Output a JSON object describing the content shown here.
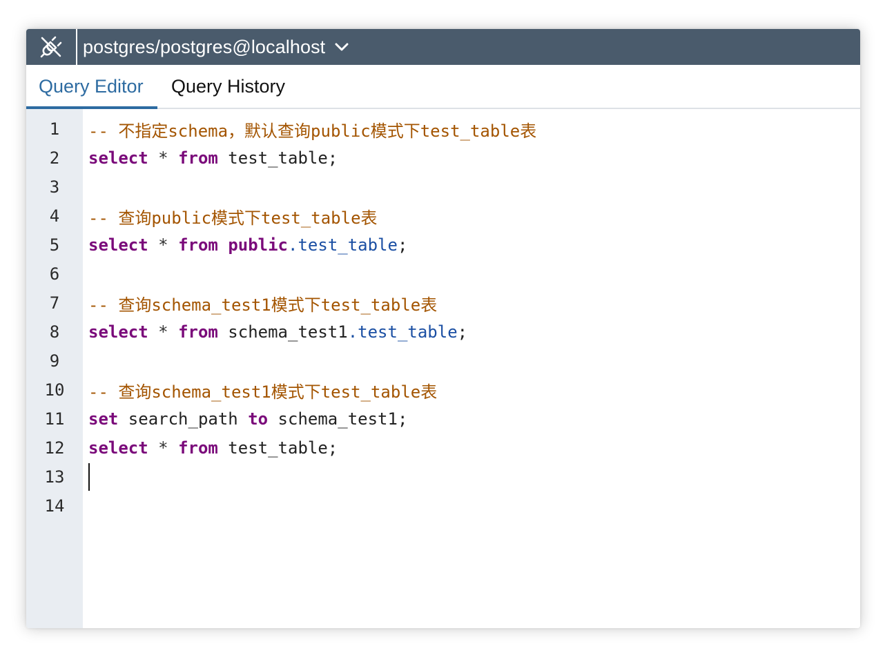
{
  "connection": {
    "label": "postgres/postgres@localhost",
    "icon": "disconnected-plug-icon",
    "dropdown_icon": "chevron-down-icon"
  },
  "tabs": [
    {
      "label": "Query Editor",
      "active": true
    },
    {
      "label": "Query History",
      "active": false
    }
  ],
  "editor": {
    "lines": [
      {
        "num": "1",
        "tokens": [
          {
            "t": "-- 不指定schema，默认查询public模式下test_table表",
            "c": "comment"
          }
        ]
      },
      {
        "num": "2",
        "tokens": [
          {
            "t": "select",
            "c": "kw"
          },
          {
            "t": " * ",
            "c": "op"
          },
          {
            "t": "from",
            "c": "kw"
          },
          {
            "t": " test_table;",
            "c": "id"
          }
        ]
      },
      {
        "num": "3",
        "tokens": []
      },
      {
        "num": "4",
        "tokens": [
          {
            "t": "-- 查询public模式下test_table表",
            "c": "comment"
          }
        ]
      },
      {
        "num": "5",
        "tokens": [
          {
            "t": "select",
            "c": "kw"
          },
          {
            "t": " * ",
            "c": "op"
          },
          {
            "t": "from",
            "c": "kw"
          },
          {
            "t": " ",
            "c": "id"
          },
          {
            "t": "public",
            "c": "kw"
          },
          {
            "t": ".test_table",
            "c": "prop"
          },
          {
            "t": ";",
            "c": "id"
          }
        ]
      },
      {
        "num": "6",
        "tokens": []
      },
      {
        "num": "7",
        "tokens": [
          {
            "t": "-- 查询schema_test1模式下test_table表",
            "c": "comment"
          }
        ]
      },
      {
        "num": "8",
        "tokens": [
          {
            "t": "select",
            "c": "kw"
          },
          {
            "t": " * ",
            "c": "op"
          },
          {
            "t": "from",
            "c": "kw"
          },
          {
            "t": " schema_test1",
            "c": "id"
          },
          {
            "t": ".test_table",
            "c": "prop"
          },
          {
            "t": ";",
            "c": "id"
          }
        ]
      },
      {
        "num": "9",
        "tokens": []
      },
      {
        "num": "10",
        "tokens": [
          {
            "t": "-- 查询schema_test1模式下test_table表",
            "c": "comment"
          }
        ]
      },
      {
        "num": "11",
        "tokens": [
          {
            "t": "set",
            "c": "kw"
          },
          {
            "t": " search_path ",
            "c": "id"
          },
          {
            "t": "to",
            "c": "kw"
          },
          {
            "t": " schema_test1;",
            "c": "id"
          }
        ]
      },
      {
        "num": "12",
        "tokens": [
          {
            "t": "select",
            "c": "kw"
          },
          {
            "t": " * ",
            "c": "op"
          },
          {
            "t": "from",
            "c": "kw"
          },
          {
            "t": " test_table;",
            "c": "id"
          }
        ]
      },
      {
        "num": "13",
        "tokens": []
      },
      {
        "num": "14",
        "tokens": []
      }
    ],
    "cursor_line": 13
  },
  "colors": {
    "toolbar_bg": "#4a5b6c",
    "accent": "#2d6ba1",
    "gutter_bg": "#e9edf2",
    "comment": "#a35400",
    "keyword": "#7a0a7a",
    "property": "#1b4fa3"
  }
}
